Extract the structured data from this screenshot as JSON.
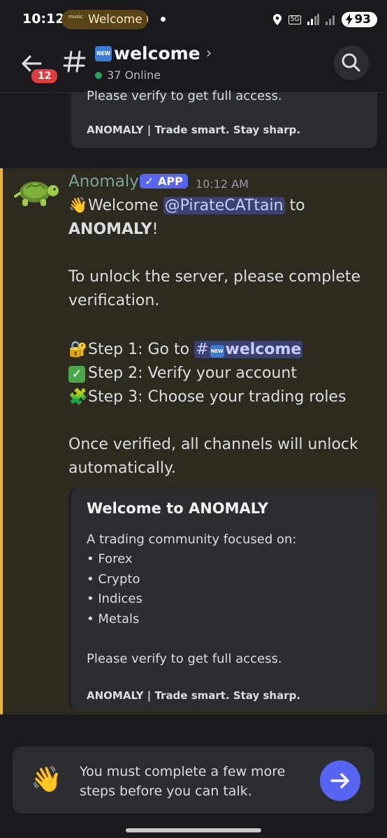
{
  "status_bar": {
    "time": "10:12",
    "notification_app": "music",
    "notification_text": "Welcome t",
    "network": "5G",
    "battery": "93"
  },
  "header": {
    "back_badge": "12",
    "channel_prefix_icon": "NEW",
    "channel_name": "welcome",
    "online_count": "37 Online"
  },
  "previous_embed": {
    "line": "Please verify to get full access.",
    "footer": "ANOMALY | Trade smart. Stay sharp."
  },
  "message": {
    "author": "Anomaly",
    "app_badge": "✓ APP",
    "timestamp": "10:12 AM",
    "line1_pre": "Welcome ",
    "mention": "@PirateCATtain",
    "line1_post": " to",
    "line2_bold": "ANOMALY",
    "line2_post": "!",
    "para2_line1": "To unlock the server, please complete",
    "para2_line2": "verification.",
    "step1_pre": "Step 1: Go to ",
    "step1_channel": "welcome",
    "step2": "Step 2: Verify your account",
    "step3": "Step 3: Choose your trading roles",
    "para4_line1": "Once verified, all channels will unlock",
    "para4_line2": "automatically."
  },
  "embed": {
    "title": "Welcome to ANOMALY",
    "intro": "A trading community focused on:",
    "items": [
      "• Forex",
      "• Crypto",
      "• Indices",
      "• Metals"
    ],
    "verify": "Please verify to get full access.",
    "footer": "ANOMALY | Trade smart. Stay sharp."
  },
  "notice": {
    "line1": "You must complete a few more",
    "line2": "steps before you can talk."
  },
  "colors": {
    "accent": "#5865f2",
    "highlight_bar": "#f0b232",
    "online": "#23a55a",
    "badge": "#e03e3e"
  }
}
